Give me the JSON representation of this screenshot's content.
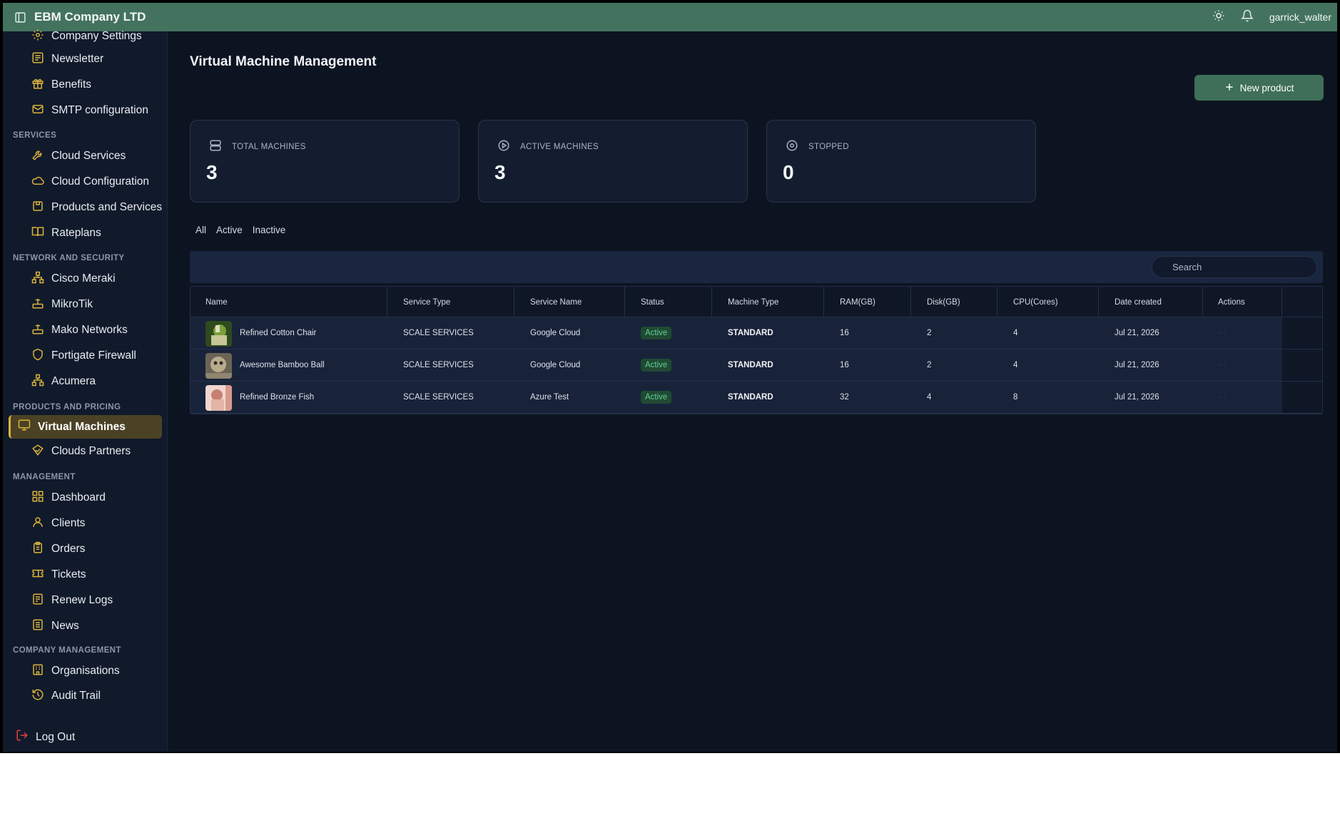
{
  "app": {
    "brand": "EBM Company LTD",
    "username": "garrick_walter"
  },
  "sidebar": {
    "top_items": [
      {
        "label": "Company Settings",
        "icon": "settings-icon"
      },
      {
        "label": "Newsletter",
        "icon": "newsletter-icon"
      },
      {
        "label": "Benefits",
        "icon": "gift-icon"
      },
      {
        "label": "SMTP configuration",
        "icon": "mail-icon"
      }
    ],
    "services": {
      "title": "SERVICES",
      "items": [
        "Cloud Services",
        "Cloud Configuration",
        "Products and Services",
        "Rateplans"
      ]
    },
    "network": {
      "title": "NETWORK AND SECURITY",
      "items": [
        "Cisco Meraki",
        "MikroTik",
        "Mako Networks",
        "Fortigate Firewall",
        "Acumera"
      ]
    },
    "products": {
      "title": "PRODUCTS AND PRICING",
      "active": "Virtual Machines",
      "items": [
        "Clouds Partners"
      ]
    },
    "management": {
      "title": "MANAGEMENT",
      "items": [
        "Dashboard",
        "Clients",
        "Orders",
        "Tickets",
        "Renew Logs",
        "News"
      ]
    },
    "company": {
      "title": "COMPANY MANAGEMENT",
      "items": [
        "Organisations",
        "Audit Trail"
      ]
    },
    "logout": "Log Out"
  },
  "main": {
    "title": "Virtual Machine Management",
    "new_button": "New product",
    "cards": [
      {
        "label": "TOTAL MACHINES",
        "value": "3",
        "icon": "server-icon"
      },
      {
        "label": "ACTIVE MACHINES",
        "value": "3",
        "icon": "play-circle-icon"
      },
      {
        "label": "STOPPED",
        "value": "0",
        "icon": "stop-circle-icon"
      }
    ],
    "tabs": [
      "All",
      "Active",
      "Inactive"
    ],
    "search_placeholder": "Search",
    "columns": [
      "Name",
      "Service Type",
      "Service Name",
      "Status",
      "Machine Type",
      "RAM(GB)",
      "Disk(GB)",
      "CPU(Cores)",
      "Date created",
      "Actions"
    ],
    "rows": [
      {
        "name": "Refined Cotton Chair",
        "service_type": "SCALE SERVICES",
        "service_name": "Google Cloud",
        "status": "Active",
        "machine_type": "STANDARD",
        "ram": "16",
        "disk": "2",
        "cpu": "4",
        "date": "Jul 21, 2026",
        "thumb_colors": [
          "#7aa03a",
          "#c8c79a"
        ]
      },
      {
        "name": "Awesome Bamboo Ball",
        "service_type": "SCALE SERVICES",
        "service_name": "Google Cloud",
        "status": "Active",
        "machine_type": "STANDARD",
        "ram": "16",
        "disk": "2",
        "cpu": "4",
        "date": "Jul 21, 2026",
        "thumb_colors": [
          "#b9ab8c",
          "#6b6455"
        ]
      },
      {
        "name": "Refined Bronze Fish",
        "service_type": "SCALE SERVICES",
        "service_name": "Azure Test",
        "status": "Active",
        "machine_type": "STANDARD",
        "ram": "32",
        "disk": "4",
        "cpu": "8",
        "date": "Jul 21, 2026",
        "thumb_colors": [
          "#e2b5a8",
          "#c77f74"
        ]
      }
    ]
  },
  "colors": {
    "topbar": "#43735e",
    "accent": "#d9b23a",
    "active_badge": "#5fd08e",
    "button": "#3f6f58"
  }
}
